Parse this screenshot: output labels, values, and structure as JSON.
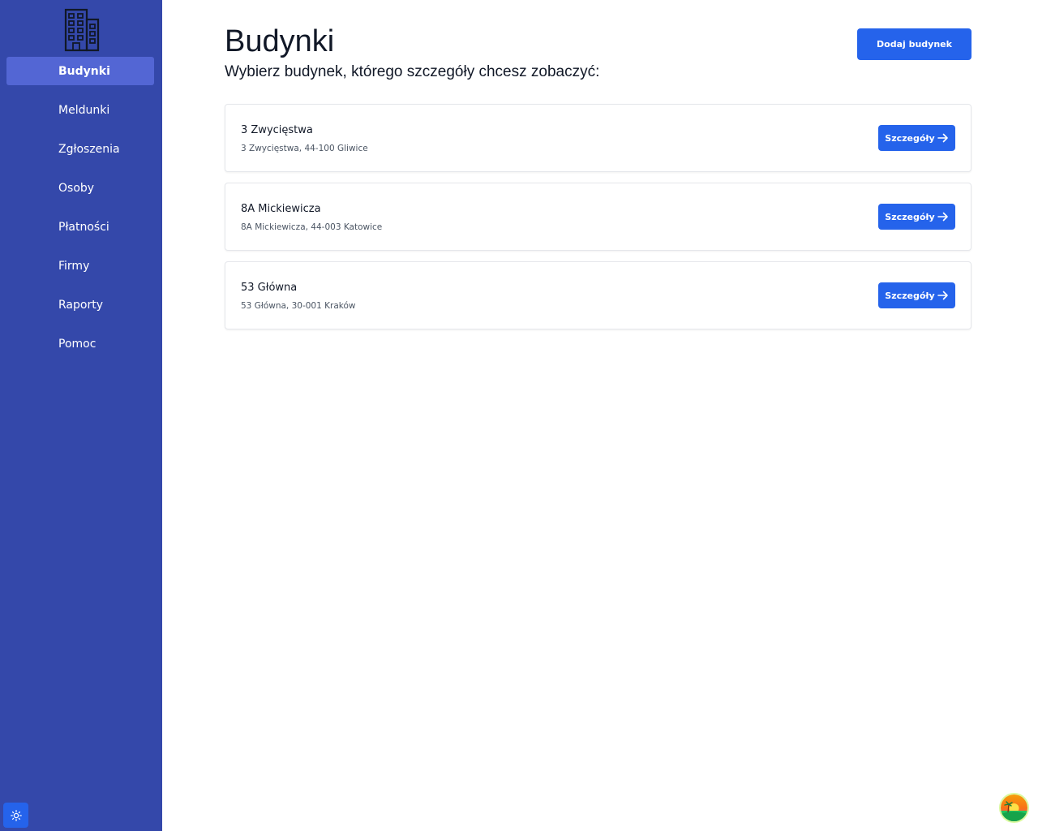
{
  "sidebar": {
    "logo_icon": "building-icon",
    "items": [
      {
        "label": "Budynki",
        "active": true
      },
      {
        "label": "Meldunki",
        "active": false
      },
      {
        "label": "Zgłoszenia",
        "active": false
      },
      {
        "label": "Osoby",
        "active": false
      },
      {
        "label": "Płatności",
        "active": false
      },
      {
        "label": "Firmy",
        "active": false
      },
      {
        "label": "Raporty",
        "active": false
      },
      {
        "label": "Pomoc",
        "active": false
      }
    ],
    "theme_toggle_icon": "sun-icon"
  },
  "main": {
    "title": "Budynki",
    "subtitle": "Wybierz budynek, którego szczegóły chcesz zobaczyć:",
    "add_button_label": "Dodaj budynek",
    "buildings": [
      {
        "name": "3 Zwycięstwa",
        "address": "3 Zwycięstwa, 44-100 Gliwice",
        "button_label": "Szczegóły"
      },
      {
        "name": "8A Mickiewicza",
        "address": "8A Mickiewicza, 44-003 Katowice",
        "button_label": "Szczegóły"
      },
      {
        "name": "53 Główna",
        "address": "53 Główna, 30-001 Kraków",
        "button_label": "Szczegóły"
      }
    ]
  },
  "colors": {
    "sidebar_bg": "#3448aa",
    "sidebar_active": "#5366d4",
    "primary": "#2563eb"
  }
}
